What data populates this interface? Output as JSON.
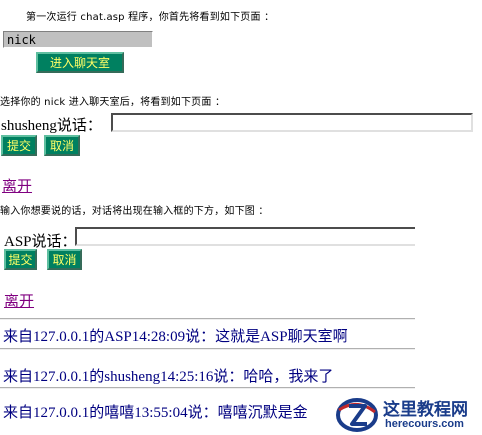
{
  "intro": {
    "line1": "第一次运行 chat.asp 程序，你首先将看到如下页面 ：",
    "line2": "选择你的 nick 进入聊天室后，将看到如下页面 ：",
    "line3": "输入你想要说的话，对话将出现在输入框的下方，如下图 ："
  },
  "login": {
    "nick_value": "nick",
    "enter_button": "进入聊天室"
  },
  "chat1": {
    "speaker_label": "shusheng说话：",
    "submit_button": "提交",
    "cancel_button": "取消",
    "leave_link": "离开"
  },
  "chat2": {
    "speaker_label": "ASP说话：",
    "submit_button": "提交",
    "cancel_button": "取消",
    "leave_link": "离开"
  },
  "messages": [
    "来自127.0.0.1的ASP14:28:09说：这就是ASP聊天室啊",
    "来自127.0.0.1的shusheng14:25:16说：哈哈，我来了",
    "来自127.0.0.1的嘻嘻13:55:04说：嘻嘻沉默是金"
  ],
  "watermark": {
    "title": "这里教程网",
    "url": "herecours.com",
    "color": "#1a3c8a",
    "accent": "#c0282a"
  }
}
